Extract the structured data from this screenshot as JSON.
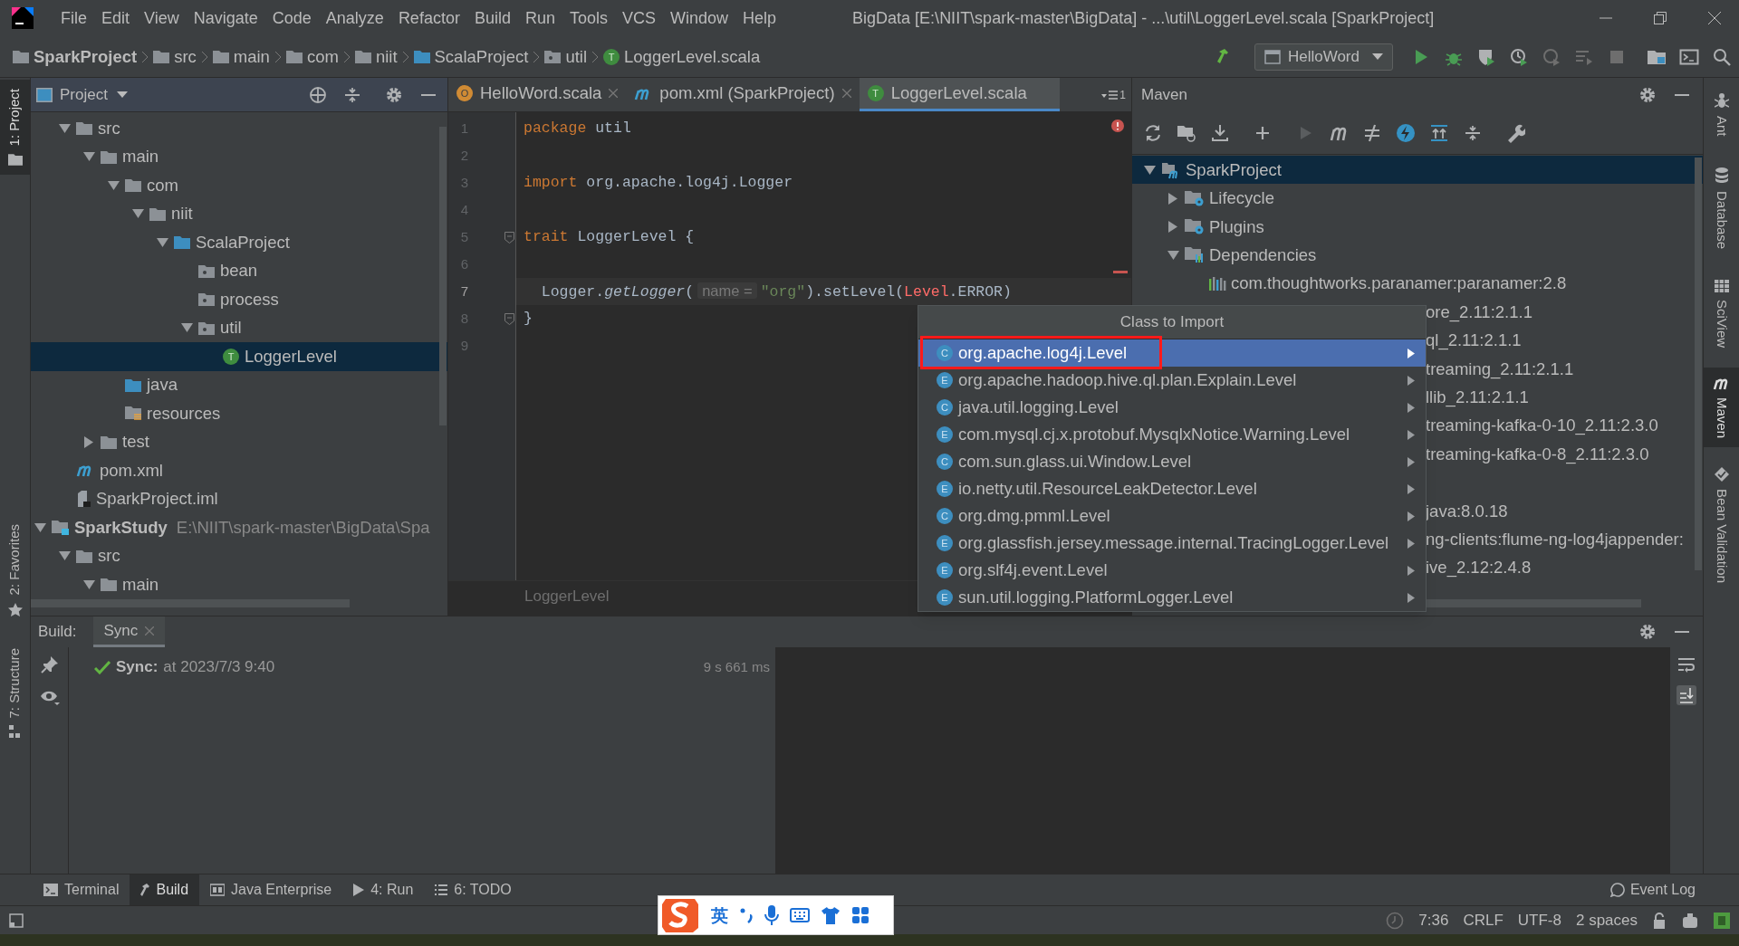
{
  "window": {
    "title": "BigData [E:\\NIIT\\spark-master\\BigData] - ...\\util\\LoggerLevel.scala [SparkProject]"
  },
  "menu": [
    "File",
    "Edit",
    "View",
    "Navigate",
    "Code",
    "Analyze",
    "Refactor",
    "Build",
    "Run",
    "Tools",
    "VCS",
    "Window",
    "Help"
  ],
  "breadcrumbs": [
    {
      "label": "SparkProject",
      "kind": "project"
    },
    {
      "label": "src",
      "kind": "folder"
    },
    {
      "label": "main",
      "kind": "folder"
    },
    {
      "label": "com",
      "kind": "folder"
    },
    {
      "label": "niit",
      "kind": "folder"
    },
    {
      "label": "ScalaProject",
      "kind": "source_folder"
    },
    {
      "label": "util",
      "kind": "package"
    },
    {
      "label": "LoggerLevel.scala",
      "kind": "trait",
      "badge": "T"
    }
  ],
  "run_config": {
    "label": "HelloWord"
  },
  "left_stripe": [
    {
      "label": "1: Project",
      "kind": "project",
      "selected": true
    },
    {
      "label": "2: Favorites",
      "kind": "favorites",
      "selected": false
    },
    {
      "label": "7: Structure",
      "kind": "structure",
      "selected": false
    }
  ],
  "project_panel": {
    "title": "Project",
    "tree": [
      {
        "kind": "scrolled_root",
        "children": [
          {
            "label": "src",
            "kind": "folder",
            "expanded": true,
            "selected": false,
            "children": [
              {
                "label": "main",
                "kind": "folder",
                "expanded": true,
                "selected": false,
                "children": [
                  {
                    "label": "com",
                    "kind": "folder",
                    "expanded": true,
                    "selected": false,
                    "children": [
                      {
                        "label": "niit",
                        "kind": "folder",
                        "expanded": true,
                        "selected": false,
                        "children": [
                          {
                            "label": "ScalaProject",
                            "kind": "source_folder",
                            "expanded": true,
                            "selected": false,
                            "children": [
                              {
                                "label": "bean",
                                "kind": "package",
                                "selected": false
                              },
                              {
                                "label": "process",
                                "kind": "package",
                                "selected": false
                              },
                              {
                                "label": "util",
                                "kind": "package",
                                "expanded": true,
                                "selected": false,
                                "children": [
                                  {
                                    "label": "LoggerLevel",
                                    "kind": "trait",
                                    "badge": "T",
                                    "selected": true
                                  }
                                ]
                              }
                            ]
                          }
                        ]
                      }
                    ]
                  },
                  {
                    "label": "java",
                    "kind": "source_folder",
                    "selected": false
                  },
                  {
                    "label": "resources",
                    "kind": "resources",
                    "selected": false
                  }
                ]
              },
              {
                "label": "test",
                "kind": "folder",
                "expanded": false,
                "selected": false
              }
            ]
          },
          {
            "label": "pom.xml",
            "kind": "maven",
            "selected": false
          },
          {
            "label": "SparkProject.iml",
            "kind": "iml",
            "selected": false
          }
        ]
      },
      {
        "label": "SparkStudy",
        "kind": "module",
        "hint": "E:\\NIIT\\spark-master\\BigData\\Spa",
        "expanded": true,
        "selected": false,
        "children": [
          {
            "label": "src",
            "kind": "folder",
            "expanded": true,
            "selected": false,
            "children": [
              {
                "label": "main",
                "kind": "folder",
                "expanded": true,
                "selected": false
              }
            ]
          }
        ]
      }
    ]
  },
  "editor": {
    "tabs": [
      {
        "label": "HelloWord.scala",
        "kind": "object",
        "badge": "O",
        "selected": false,
        "closable": true
      },
      {
        "label": "pom.xml (SparkProject)",
        "kind": "maven",
        "selected": false,
        "closable": true
      },
      {
        "label": "LoggerLevel.scala",
        "kind": "trait",
        "badge": "T",
        "selected": true,
        "closable": false
      }
    ],
    "tab_count": "1",
    "lines": [
      {
        "number": "1",
        "tokens": [
          {
            "kind": "keyword",
            "text": "package"
          },
          {
            "kind": "plain",
            "text": " util"
          }
        ]
      },
      {
        "number": "2"
      },
      {
        "number": "3",
        "tokens": [
          {
            "kind": "keyword",
            "text": "import"
          },
          {
            "kind": "plain",
            "text": " org.apache.log4j.Logger"
          }
        ]
      },
      {
        "number": "4"
      },
      {
        "number": "5",
        "fold": true,
        "tokens": [
          {
            "kind": "keyword",
            "text": "trait"
          },
          {
            "kind": "plain",
            "text": " LoggerLevel {"
          }
        ]
      },
      {
        "number": "6"
      },
      {
        "number": "7",
        "current": true,
        "tokens": [
          {
            "kind": "plain",
            "text": "  Logger."
          },
          {
            "kind": "method",
            "text": "getLogger"
          },
          {
            "kind": "plain",
            "text": "("
          },
          {
            "kind": "hint",
            "text": "name ="
          },
          {
            "kind": "string",
            "text": "\"org\""
          },
          {
            "kind": "plain",
            "text": ").setLevel("
          },
          {
            "kind": "error",
            "text": "Level"
          },
          {
            "kind": "plain",
            "text": ".ERROR)"
          }
        ]
      },
      {
        "number": "8",
        "fold": true,
        "tokens": [
          {
            "kind": "plain",
            "text": "}"
          }
        ]
      },
      {
        "number": "9"
      }
    ],
    "breadcrumb": "LoggerLevel"
  },
  "import_popup": {
    "title": "Class to Import",
    "items": [
      {
        "label": "org.apache.log4j.Level",
        "badge": "C",
        "selected": true,
        "highlighted": true
      },
      {
        "label": "org.apache.hadoop.hive.ql.plan.Explain.Level",
        "badge": "E",
        "selected": false,
        "highlighted": false
      },
      {
        "label": "java.util.logging.Level",
        "badge": "C",
        "selected": false,
        "highlighted": false
      },
      {
        "label": "com.mysql.cj.x.protobuf.MysqlxNotice.Warning.Level",
        "badge": "E",
        "selected": false,
        "highlighted": false
      },
      {
        "label": "com.sun.glass.ui.Window.Level",
        "badge": "C",
        "selected": false,
        "highlighted": false
      },
      {
        "label": "io.netty.util.ResourceLeakDetector.Level",
        "badge": "E",
        "selected": false,
        "highlighted": false
      },
      {
        "label": "org.dmg.pmml.Level",
        "badge": "C",
        "selected": false,
        "highlighted": false
      },
      {
        "label": "org.glassfish.jersey.message.internal.TracingLogger.Level",
        "badge": "E",
        "selected": false,
        "highlighted": false
      },
      {
        "label": "org.slf4j.event.Level",
        "badge": "E",
        "selected": false,
        "highlighted": false
      },
      {
        "label": "sun.util.logging.PlatformLogger.Level",
        "badge": "E",
        "selected": false,
        "highlighted": false
      }
    ]
  },
  "maven_panel": {
    "title": "Maven",
    "tree": [
      {
        "label": "SparkProject",
        "kind": "maven_project",
        "expanded": true,
        "selected": true,
        "children": [
          {
            "label": "Lifecycle",
            "kind": "lifecycle",
            "expanded": false,
            "selected": false
          },
          {
            "label": "Plugins",
            "kind": "plugins",
            "expanded": false,
            "selected": false
          },
          {
            "label": "Dependencies",
            "kind": "dependencies",
            "expanded": true,
            "selected": false,
            "children": [
              {
                "label": "com.thoughtworks.paranamer:paranamer:2.8",
                "kind": "library",
                "selected": false
              },
              {
                "label": "ore_2.11:2.1.1",
                "kind": "covered_library",
                "selected": false
              },
              {
                "label": "ql_2.11:2.1.1",
                "kind": "covered_library",
                "selected": false
              },
              {
                "label": "treaming_2.11:2.1.1",
                "kind": "covered_library",
                "selected": false
              },
              {
                "label": "llib_2.11:2.1.1",
                "kind": "covered_library",
                "selected": false
              },
              {
                "label": "treaming-kafka-0-10_2.11:2.3.0",
                "kind": "covered_library",
                "selected": false
              },
              {
                "label": "treaming-kafka-0-8_2.11:2.3.0",
                "kind": "covered_library",
                "selected": false
              },
              {
                "kind": "covered_library"
              },
              {
                "label": "java:8.0.18",
                "kind": "covered_library",
                "selected": false
              },
              {
                "label": "ng-clients:flume-ng-log4jappender:",
                "kind": "covered_library",
                "selected": false
              },
              {
                "label": "ive_2.12:2.4.8",
                "kind": "covered_library",
                "selected": false
              }
            ]
          }
        ]
      }
    ]
  },
  "right_stripe": [
    {
      "label": "Ant",
      "kind": "ant",
      "selected": false
    },
    {
      "label": "Database",
      "kind": "database",
      "selected": false
    },
    {
      "label": "SciView",
      "kind": "sciview",
      "selected": false
    },
    {
      "label": "Maven",
      "kind": "maven",
      "selected": true
    },
    {
      "label": "Bean Validation",
      "kind": "bean",
      "selected": false
    }
  ],
  "build_panel": {
    "title": "Build:",
    "tabs": [
      {
        "label": "Sync",
        "selected": true
      }
    ],
    "entries": [
      {
        "label": "Sync:",
        "detail": "at 2023/7/3 9:40",
        "duration": "9 s 661 ms"
      }
    ]
  },
  "tool_windows": [
    {
      "label": "Terminal",
      "kind": "terminal",
      "selected": false
    },
    {
      "label": "Build",
      "kind": "build",
      "selected": true
    },
    {
      "label": "Java Enterprise",
      "kind": "enterprise",
      "selected": false
    },
    {
      "label": "4: Run",
      "kind": "run",
      "selected": false
    },
    {
      "label": "6: TODO",
      "kind": "todo",
      "selected": false
    }
  ],
  "event_log": "Event Log",
  "status_bar": {
    "position": "7:36",
    "line_separator": "CRLF",
    "encoding": "UTF-8",
    "indent": "2 spaces"
  },
  "ime_bar": {
    "mode": "英"
  }
}
